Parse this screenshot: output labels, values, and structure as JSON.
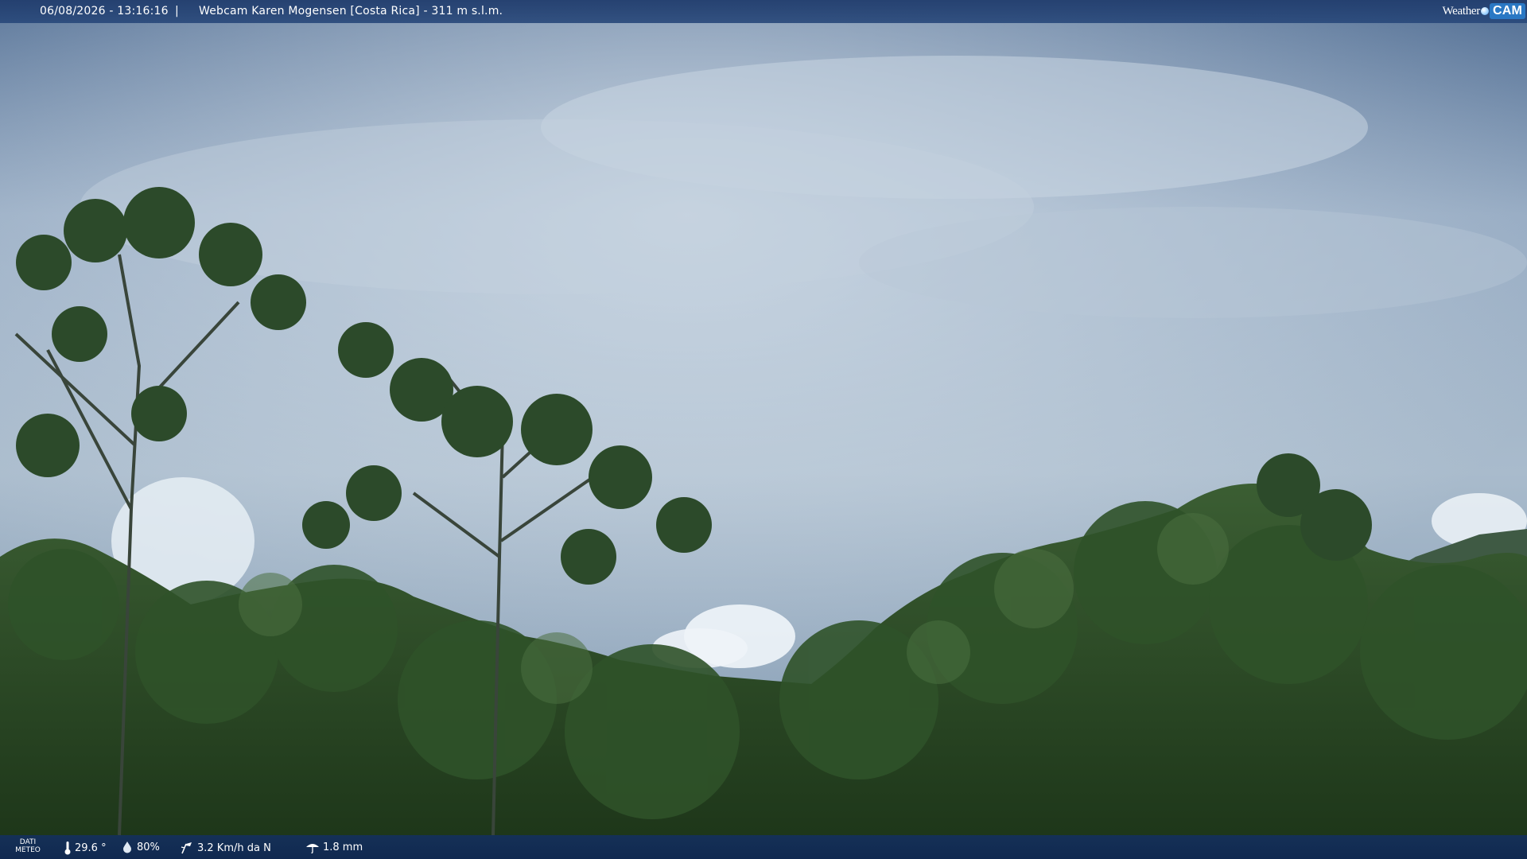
{
  "overlay": {
    "timestamp": "06/08/2026 - 13:16:16",
    "separator": "|",
    "camera_title": "Webcam Karen Mogensen [Costa Rica] - 311 m s.l.m.",
    "brand_word": "Weather",
    "brand_cam": "CAM"
  },
  "weather": {
    "label_line1": "DATI",
    "label_line2": "METEO",
    "temperature": "29.6 °",
    "humidity": "80%",
    "wind": "3.2 Km/h da N",
    "rain": "1.8 mm"
  },
  "colors": {
    "bar_background": "#1e4278",
    "text": "#ffffff",
    "sky": "#8fa3b8",
    "foliage": "#2b4a26"
  },
  "icons": [
    "thermometer-icon",
    "humidity-drop-icon",
    "wind-icon",
    "rain-icon"
  ]
}
